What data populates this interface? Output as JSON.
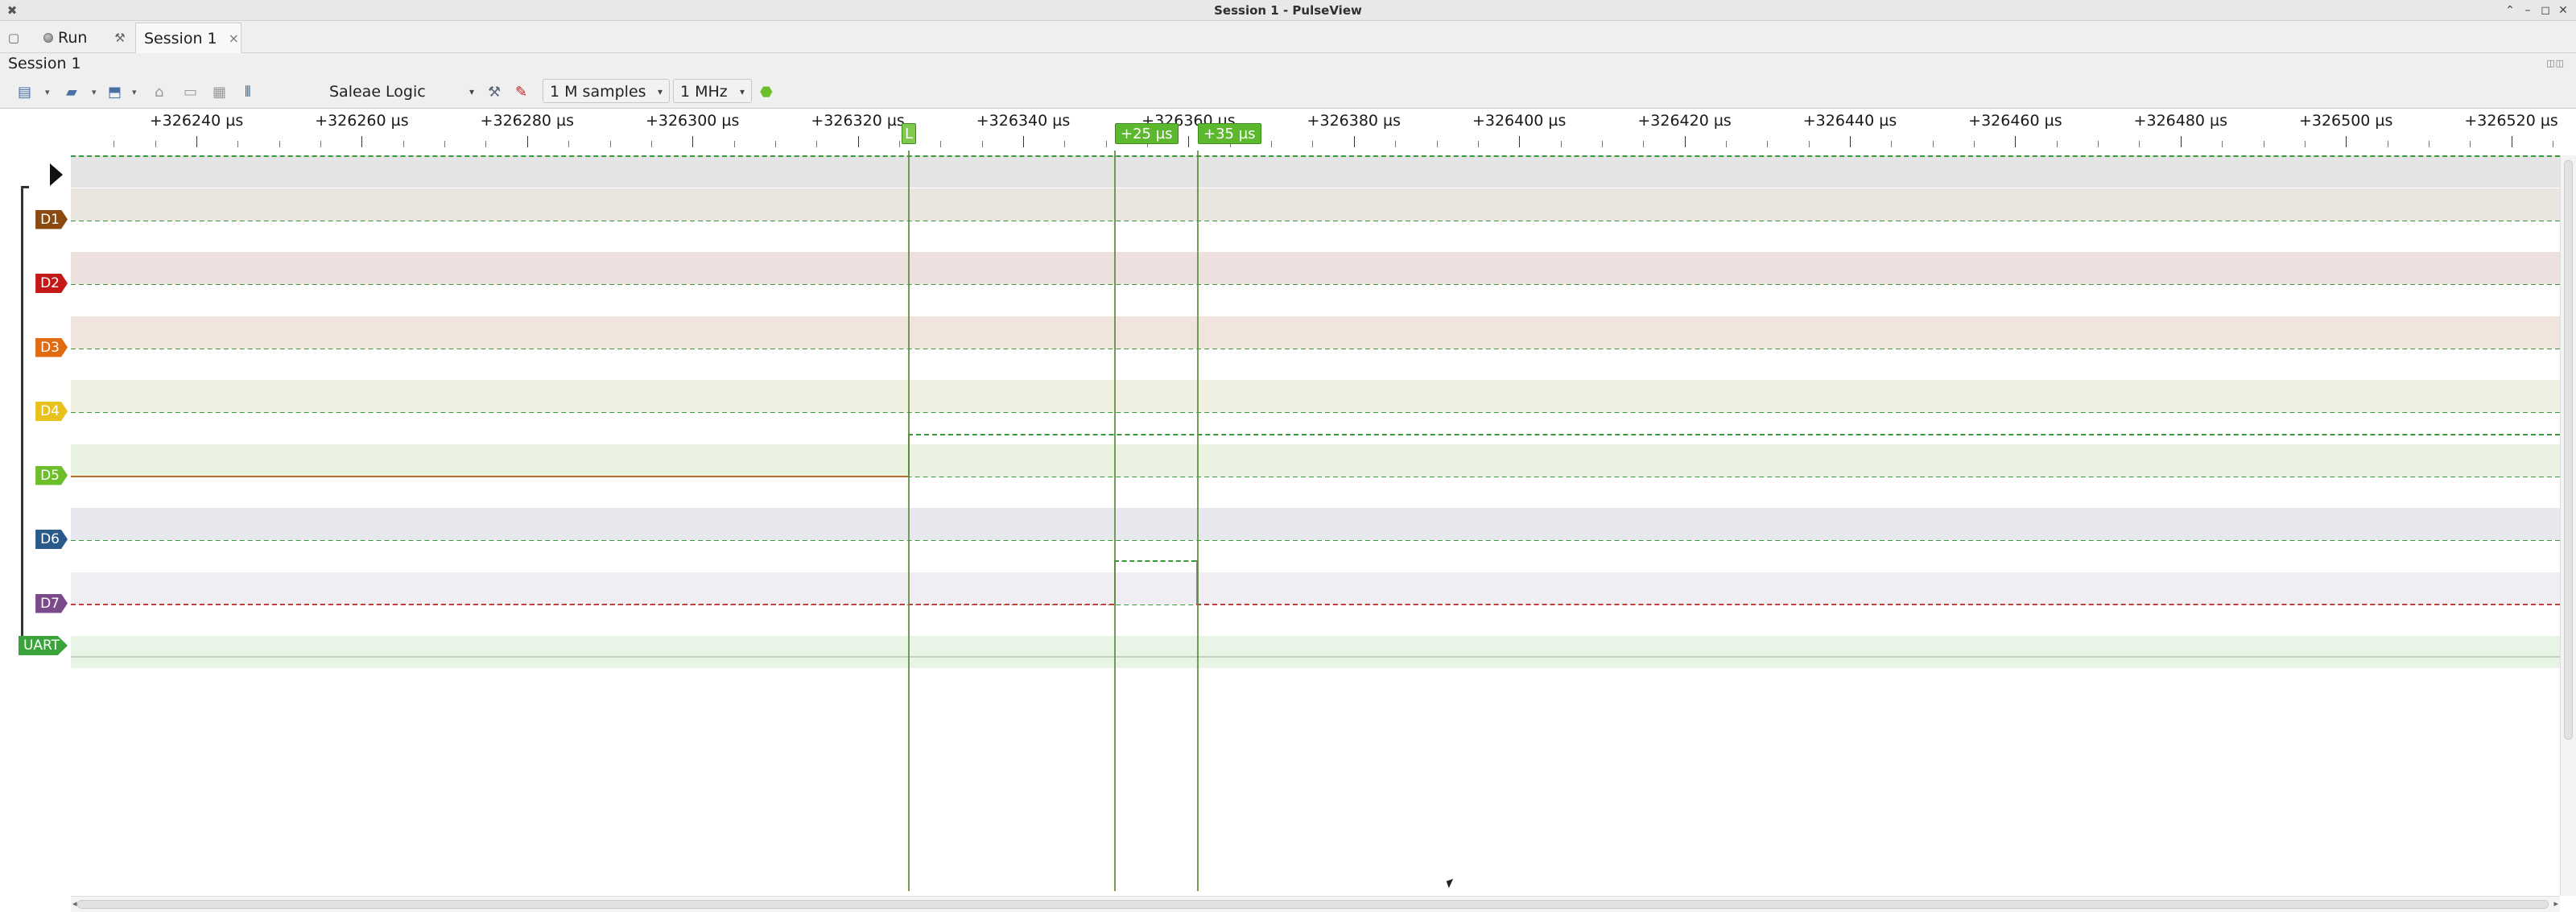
{
  "window": {
    "title": "Session 1 - PulseView"
  },
  "toolbar": {
    "run_label": "Run",
    "tab_label": "Session 1",
    "tab_close": "×"
  },
  "session": {
    "label": "Session 1",
    "device": "Saleae Logic",
    "samples": "1 M samples",
    "rate": "1 MHz"
  },
  "ruler": {
    "ticks": [
      "+326240 µs",
      "+326260 µs",
      "+326280 µs",
      "+326300 µs",
      "+326320 µs",
      "+326340 µs",
      "+326360 µs",
      "+326380 µs",
      "+326400 µs",
      "+326420 µs",
      "+326440 µs",
      "+326460 µs",
      "+326480 µs",
      "+326500 µs",
      "+326520 µs"
    ],
    "cursor_flag": "L",
    "marker1": "+25 µs",
    "marker2": "+35 µs"
  },
  "channels": [
    {
      "name": "D1",
      "color": "#8a4a10"
    },
    {
      "name": "D2",
      "color": "#c41818"
    },
    {
      "name": "D3",
      "color": "#e06b10"
    },
    {
      "name": "D4",
      "color": "#e8c21a"
    },
    {
      "name": "D5",
      "color": "#6cbf2a"
    },
    {
      "name": "D6",
      "color": "#2a5a8a"
    },
    {
      "name": "D7",
      "color": "#7a4a8a"
    },
    {
      "name": "UART",
      "color": "#3aa33a"
    }
  ],
  "colors": {
    "green_line": "#3a9a3a",
    "accent": "#5cb82e"
  },
  "icons": [
    "app-icon",
    "run-icon",
    "settings-icon",
    "new-session-icon",
    "open-icon",
    "save-icon",
    "zoom-in-icon",
    "zoom-out-icon",
    "zoom-fit-icon",
    "cursor-icon",
    "configure-icon",
    "probe-icon",
    "trigger-icon"
  ]
}
